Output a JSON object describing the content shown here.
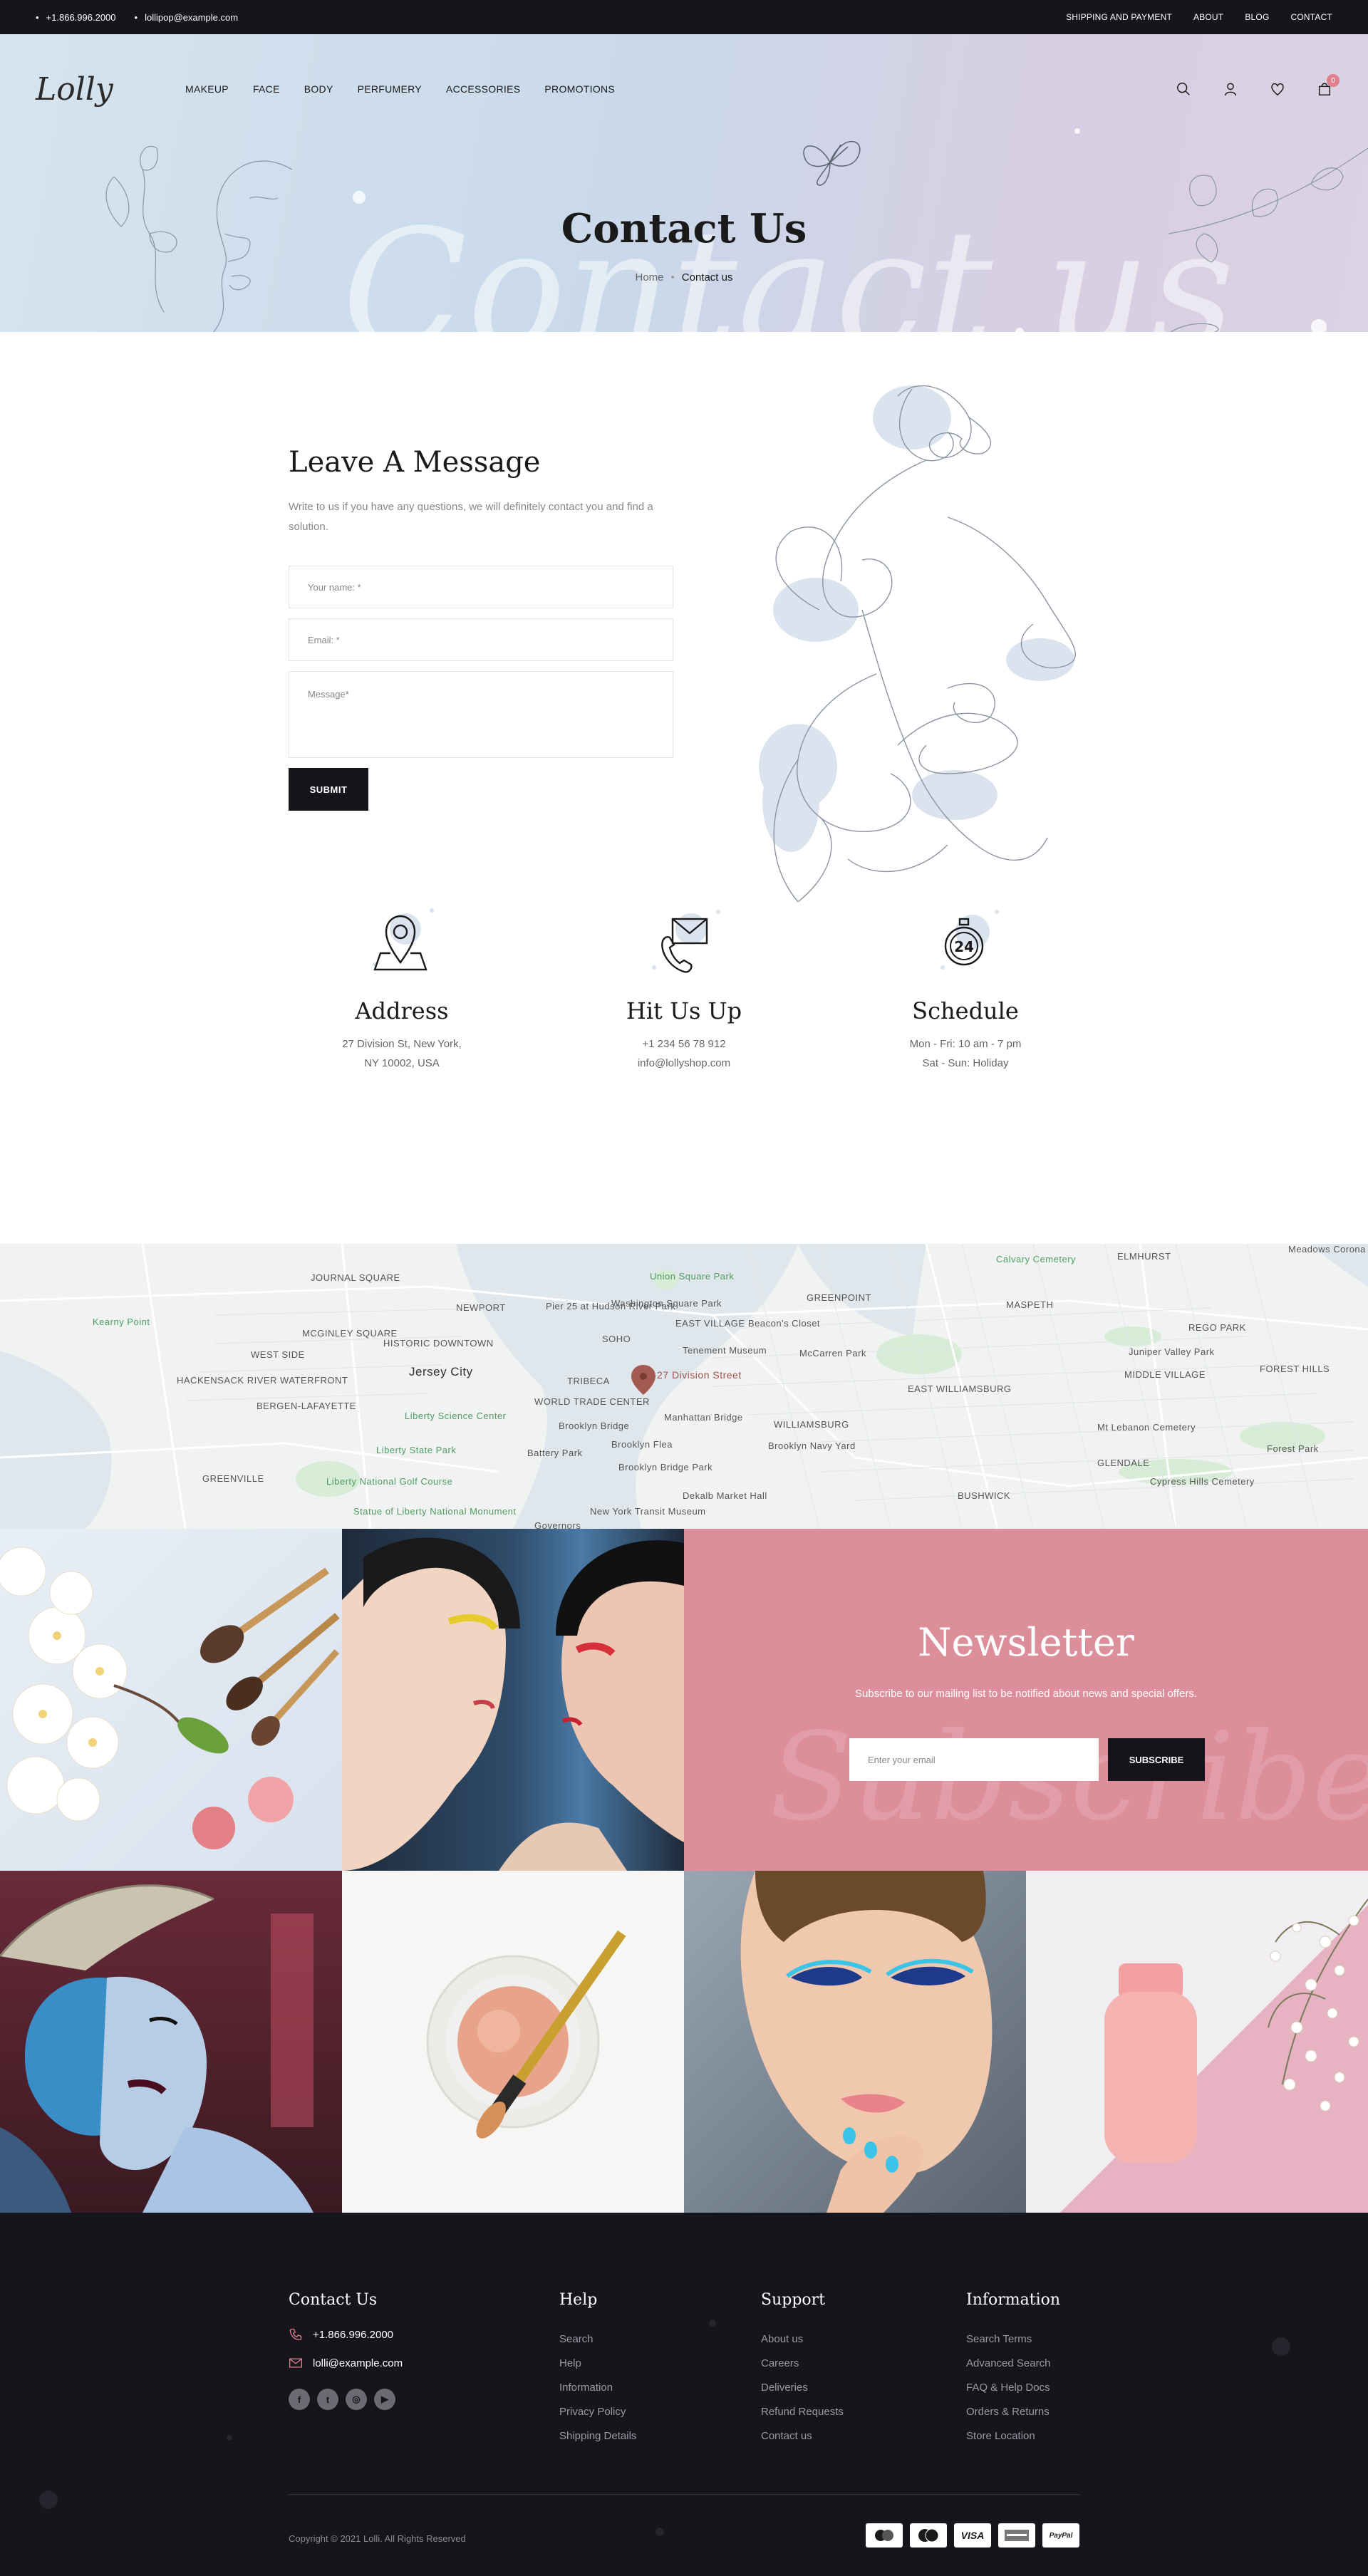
{
  "topbar": {
    "phone": "+1.866.996.2000",
    "email": "lollipop@example.com",
    "links": [
      "SHIPPING AND PAYMENT",
      "ABOUT",
      "BLOG",
      "CONTACT"
    ]
  },
  "header": {
    "logo": "Lolly",
    "menu": [
      "MAKEUP",
      "FACE",
      "BODY",
      "PERFUMERY",
      "ACCESSORIES",
      "PROMOTIONS"
    ],
    "cart_count": "0"
  },
  "hero": {
    "title": "Contact Us",
    "watermark": "Contact us",
    "breadcrumb_home": "Home",
    "breadcrumb_current": "Contact us"
  },
  "form": {
    "heading": "Leave A Message",
    "intro": "Write to us if you have any questions, we will definitely contact you and find a solution.",
    "name_placeholder": "Your name: *",
    "email_placeholder": "Email: *",
    "message_placeholder": "Message*",
    "submit_label": "SUBMIT"
  },
  "info": [
    {
      "title": "Address",
      "lines": [
        "27 Division St, New York,",
        "NY 10002, USA"
      ]
    },
    {
      "title": "Hit Us Up",
      "lines": [
        "+1 234 56 78 912",
        "info@lollyshop.com"
      ]
    },
    {
      "title": "Schedule",
      "lines": [
        "Mon - Fri: 10 am - 7 pm",
        "Sat - Sun: Holiday"
      ]
    }
  ],
  "map": {
    "pin_label": "27 Division Street",
    "labels": {
      "jersey_city": "Jersey City",
      "journal_square": "JOURNAL SQUARE",
      "mcginley": "MCGINLEY SQUARE",
      "historic": "HISTORIC DOWNTOWN",
      "west_side": "WEST SIDE",
      "newport": "NEWPORT",
      "soho": "SOHO",
      "tribeca": "TRIBECA",
      "east_village": "EAST VILLAGE",
      "union_square": "Union Square Park",
      "washington": "Washington Square Park",
      "pier25": "Pier 25 at Hudson River Park",
      "tenement": "Tenement Museum",
      "beacon": "Beacon's Closet",
      "mccarren": "McCarren Park",
      "greenpoint": "GREENPOINT",
      "maspeth": "MASPETH",
      "elmhurst": "ELMHURST",
      "calvary": "Calvary Cemetery",
      "meadows": "Meadows Corona Park",
      "rego": "REGO PARK",
      "juniper": "Juniper Valley Park",
      "middle_village": "MIDDLE VILLAGE",
      "forest_hills": "FOREST HILLS",
      "williamsburg": "WILLIAMSBURG",
      "east_williamsburg": "EAST WILLIAMSBURG",
      "manhattan_bridge": "Manhattan Bridge",
      "brooklyn_bridge": "Brooklyn Bridge",
      "brooklyn_flea": "Brooklyn Flea",
      "navy_yard": "Brooklyn Navy Yard",
      "brooklyn_bridge_park": "Brooklyn Bridge Park",
      "battery": "Battery Park",
      "wtc": "WORLD TRADE CENTER",
      "liberty_science": "Liberty Science Center",
      "liberty_state": "Liberty State Park",
      "statue": "Statue of Liberty National Monument",
      "liberty_golf": "Liberty National Golf Course",
      "kearny": "Kearny Point",
      "bergen": "BERGEN-LAFAYETTE",
      "greenville": "GREENVILLE",
      "hackensack": "HACKENSACK RIVER WATERFRONT",
      "mt_lebanon": "Mt Lebanon Cemetery",
      "cypress": "Cypress Hills Cemetery",
      "glendale": "GLENDALE",
      "forest_park": "Forest Park",
      "bushwick": "BUSHWICK",
      "transit": "New York Transit Museum",
      "dekalb": "Dekalb Market Hall",
      "governors": "Governors"
    }
  },
  "newsletter": {
    "title": "Newsletter",
    "watermark": "Subscribe",
    "text": "Subscribe to our mailing list to be notified about news and special offers.",
    "placeholder": "Enter your email",
    "button": "SUBSCRIBE"
  },
  "footer": {
    "contact": {
      "title": "Contact Us",
      "phone": "+1.866.996.2000",
      "email": "lolli@example.com"
    },
    "help": {
      "title": "Help",
      "links": [
        "Search",
        "Help",
        "Information",
        "Privacy Policy",
        "Shipping Details"
      ]
    },
    "support": {
      "title": "Support",
      "links": [
        "About us",
        "Careers",
        "Deliveries",
        "Refund Requests",
        "Contact us"
      ]
    },
    "information": {
      "title": "Information",
      "links": [
        "Search Terms",
        "Advanced Search",
        "FAQ & Help Docs",
        "Orders & Returns",
        "Store Location"
      ]
    },
    "copyright": "Copyright © 2021 Lolli.  All Rights Reserved",
    "payments": [
      "Maestro",
      "MasterCard",
      "VISA",
      "American Express",
      "PayPal"
    ],
    "payment_labels": {
      "visa": "VISA",
      "paypal": "PayPal"
    }
  },
  "colors": {
    "dark": "#16151c",
    "pink": "#dc8e9a",
    "hero_blue": "#c9d9ea",
    "badge": "#e07f8e"
  }
}
